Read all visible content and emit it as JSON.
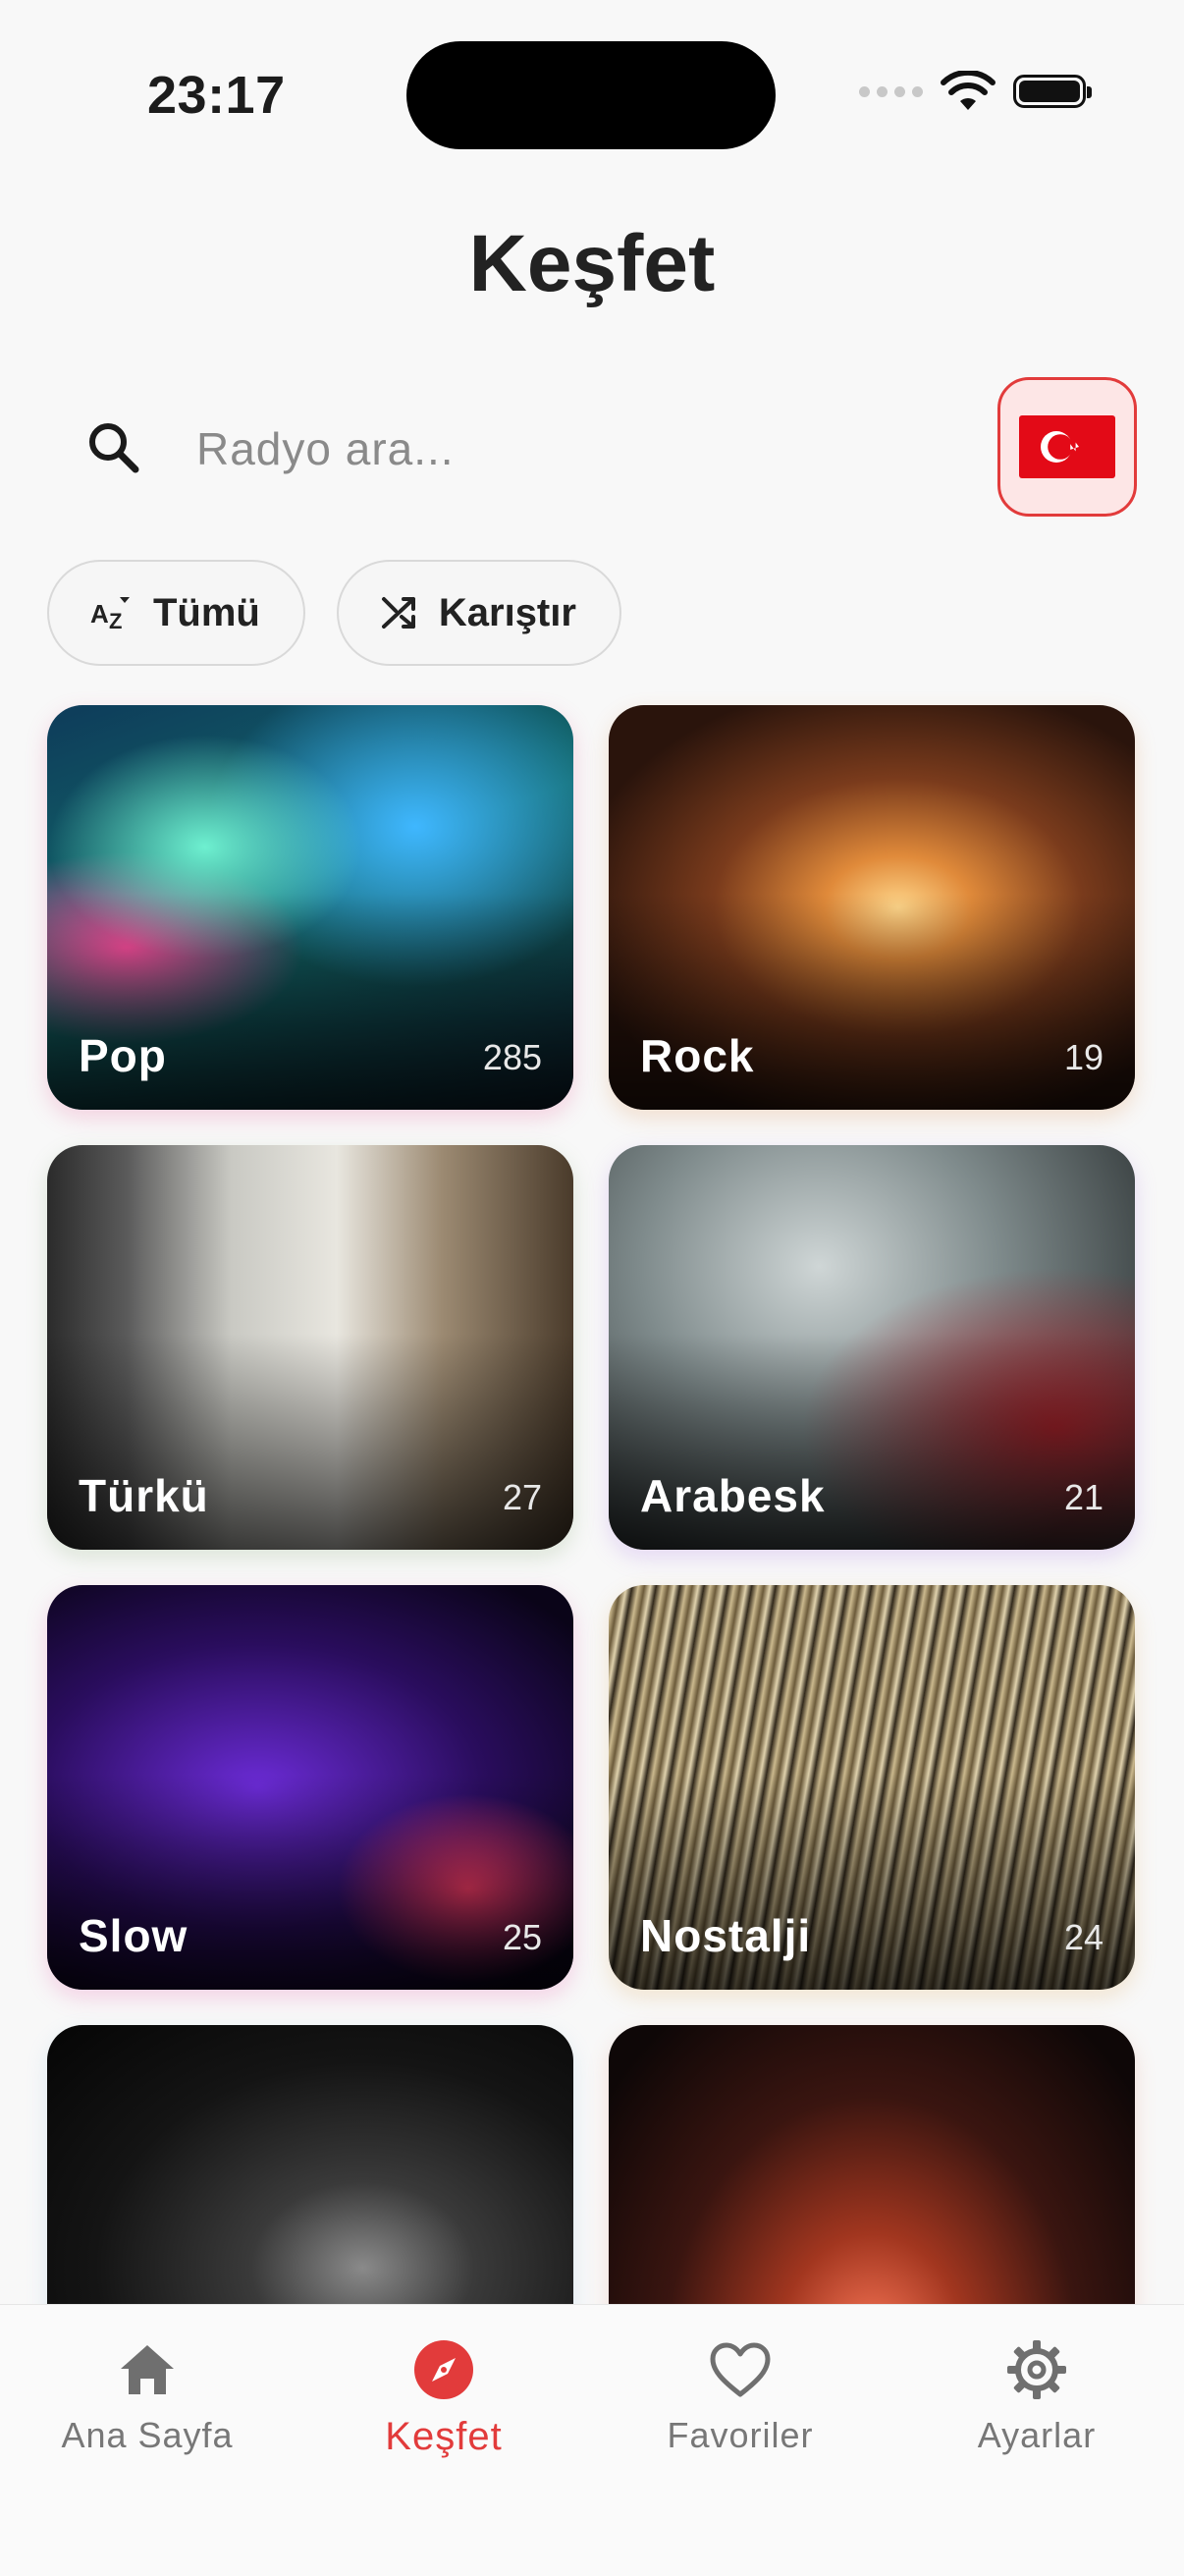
{
  "status_bar": {
    "time": "23:17"
  },
  "page": {
    "title": "Keşfet"
  },
  "search": {
    "placeholder": "Radyo ara...",
    "value": ""
  },
  "country_selector": {
    "flag": "turkey-flag-icon"
  },
  "chips": [
    {
      "label": "Tümü",
      "icon": "sort-az-icon"
    },
    {
      "label": "Karıştır",
      "icon": "shuffle-icon"
    }
  ],
  "genres": [
    {
      "name": "Pop",
      "count": "285"
    },
    {
      "name": "Rock",
      "count": "19"
    },
    {
      "name": "Türkü",
      "count": "27"
    },
    {
      "name": "Arabesk",
      "count": "21"
    },
    {
      "name": "Slow",
      "count": "25"
    },
    {
      "name": "Nostalji",
      "count": "24"
    },
    {
      "name": "",
      "count": ""
    },
    {
      "name": "",
      "count": ""
    }
  ],
  "bottom_nav": [
    {
      "label": "Ana Sayfa",
      "icon": "home-icon"
    },
    {
      "label": "Keşfet",
      "icon": "compass-icon",
      "active": true
    },
    {
      "label": "Favoriler",
      "icon": "heart-icon"
    },
    {
      "label": "Ayarlar",
      "icon": "gear-icon"
    }
  ],
  "colors": {
    "accent": "#e23b3b",
    "background": "#f8f8f8"
  }
}
